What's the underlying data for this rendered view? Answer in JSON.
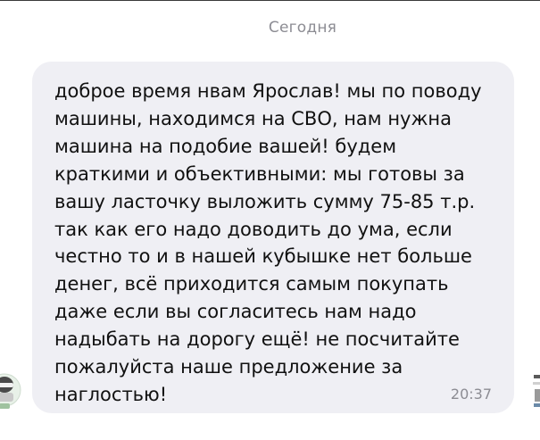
{
  "chat": {
    "date_divider": "Сегодня",
    "messages": [
      {
        "text": "доброе время нвам Ярослав! мы по поводу\nмашины, находимся на СВО, нам нужна\nмашина на подобие вашей! будем\nкраткими и объективными: мы готовы за\nвашу ласточку выложить сумму 75-85 т.р.\nтак как его надо доводить до ума, если\nчестно то и в нашей кубышке нет больше\nденег, всё приходится самым покупать\nдаже если вы согласитесь нам надо\nнадыбать на дорогу ещё! не посчитайте\nпожалуйста наше предложение за\nнаглостью!",
        "time": "20:37",
        "bubble_color": "#efeff4"
      }
    ],
    "left_avatar_icon": "sender-avatar-icon",
    "right_avatar_icon": "recipient-avatar-icon"
  }
}
